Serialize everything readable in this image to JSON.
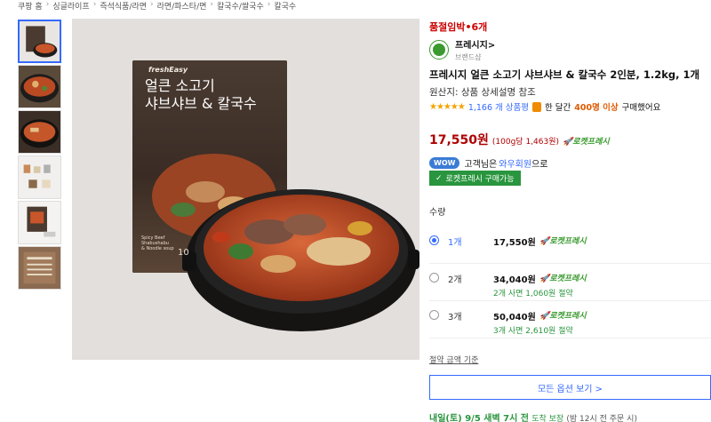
{
  "breadcrumb": [
    "쿠팡 홈",
    "싱글라이프",
    "즉석식품/라면",
    "라면/파스타/면",
    "칼국수/쌀국수",
    "칼국수"
  ],
  "product": {
    "stock_status": "품절임박•6개",
    "brand_name": "프레시지",
    "brand_chevron": ">",
    "brand_shop": "브랜드샵",
    "title": "프레시지 얼큰 소고기 샤브샤브 & 칼국수 2인분, 1.2kg, 1개",
    "origin": "원산지: 상품 상세설명 참조",
    "rating_stars": "★★★★★",
    "review_count": "1,166 개 상품평",
    "purchase_prefix": "한 달간",
    "purchase_count": "400명 이상",
    "purchase_suffix": "구매했어요",
    "price": "17,550원",
    "unit_price": "(100g당 1,463원)",
    "rocket_label": "로켓프레시",
    "wow_badge": "WOW",
    "wow_text_prefix": "고객님은",
    "wow_link": "와우회원",
    "wow_text_suffix": "으로",
    "rf_button": "로켓프레시 구매가능"
  },
  "packaging": {
    "brand": "freshEasy",
    "line1": "얼큰 소고기",
    "line2": "샤브샤브 & 칼국수",
    "small1": "Spicy Beef",
    "small2": "Shabushabu",
    "small3": "& Noodle soup",
    "weight": "10"
  },
  "quantity_label": "수량",
  "options": [
    {
      "qty": "1개",
      "price": "17,550원",
      "rocket": "로켓프레시",
      "saving": ""
    },
    {
      "qty": "2개",
      "price": "34,040원",
      "rocket": "로켓프레시",
      "saving": "2개 사면 1,060원 절약"
    },
    {
      "qty": "3개",
      "price": "50,040원",
      "rocket": "로켓프레시",
      "saving": "3개 사면 2,610원 절약"
    }
  ],
  "savings_basis": "절약 금액 기준",
  "all_options_button": "모든 옵션 보기 >",
  "delivery": {
    "main": "내일(토) 9/5 새벽 7시 전",
    "suffix": "도착 보장",
    "note": "(밤 12시 전 주문 시)"
  },
  "colors": {
    "price": "#ae0000",
    "accent": "#346aff",
    "rocket": "#0073e9",
    "green": "#29953e"
  }
}
